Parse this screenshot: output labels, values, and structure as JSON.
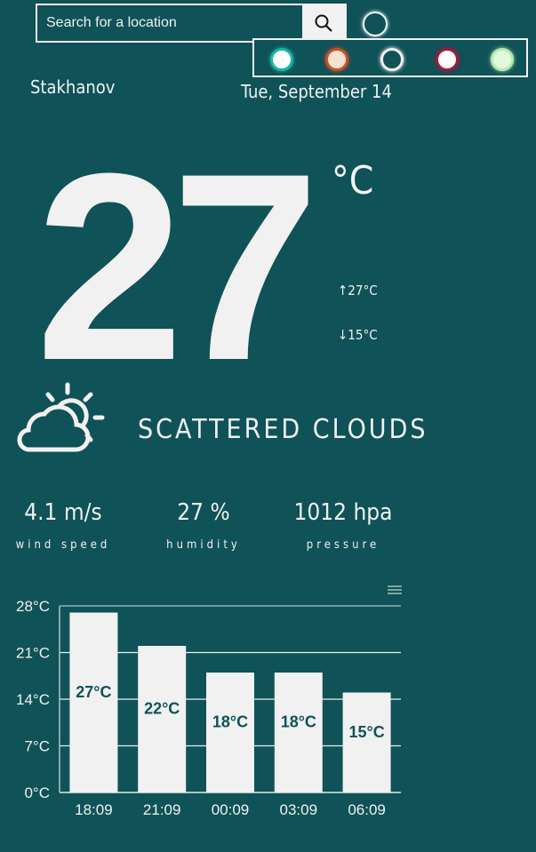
{
  "search": {
    "placeholder": "Search for a location"
  },
  "theme_colors": [
    "#1bb5a5",
    "#c8502a",
    "#0f5257",
    "#9c1b3c",
    "#b8eab0"
  ],
  "theme_fills": [
    "#ffffff",
    "#f5e3d0",
    "#0f5257",
    "#ffffff",
    "#e3f9dc"
  ],
  "location": "Stakhanov",
  "date": "Tue, September 14",
  "current": {
    "temp": "27",
    "unit": "°C",
    "high": "↑27°C",
    "low": "↓15°C",
    "description": "SCATTERED CLOUDS",
    "icon": "partly-cloudy-icon"
  },
  "stats": [
    {
      "value": "4.1 m/s",
      "label": "wind speed"
    },
    {
      "value": "27 %",
      "label": "humidity"
    },
    {
      "value": "1012 hpa",
      "label": "pressure"
    }
  ],
  "chart_data": {
    "type": "bar",
    "categories": [
      "18:09",
      "21:09",
      "00:09",
      "03:09",
      "06:09"
    ],
    "values": [
      27,
      22,
      18,
      18,
      15
    ],
    "data_labels": [
      "27°C",
      "22°C",
      "18°C",
      "18°C",
      "15°C"
    ],
    "yticks": [
      "0°C",
      "7°C",
      "14°C",
      "21°C",
      "28°C"
    ],
    "ylim": [
      0,
      28
    ],
    "grid": true,
    "bar_color": "#f1f1f1"
  }
}
